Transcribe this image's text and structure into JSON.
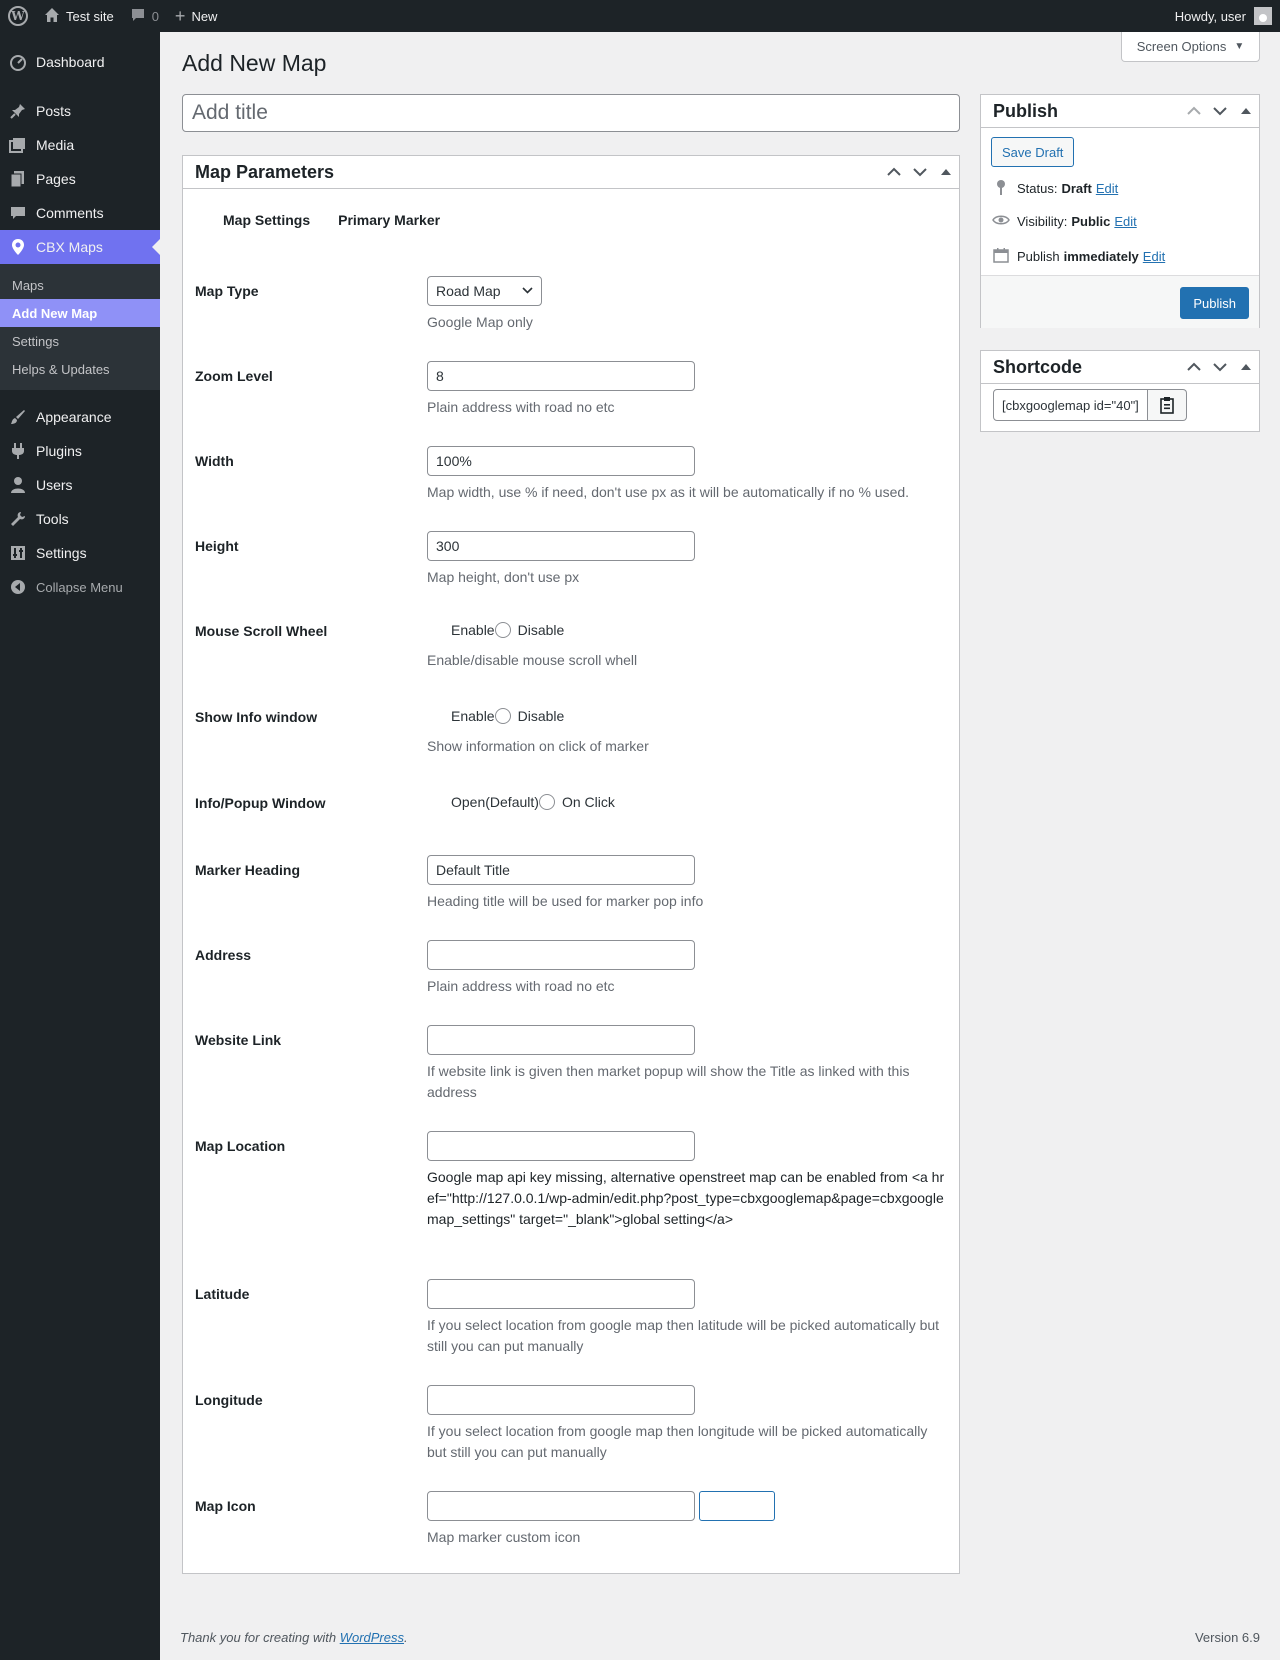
{
  "adminbar": {
    "site_name": "Test site",
    "comments_count": "0",
    "new_label": "New",
    "howdy": "Howdy, user"
  },
  "sidebar": {
    "items": [
      {
        "label": "Dashboard",
        "icon": "dashboard-icon"
      },
      {
        "label": "Posts",
        "icon": "pin-icon"
      },
      {
        "label": "Media",
        "icon": "media-icon"
      },
      {
        "label": "Pages",
        "icon": "pages-icon"
      },
      {
        "label": "Comments",
        "icon": "comments-icon"
      },
      {
        "label": "CBX Maps",
        "icon": "location-pin-icon"
      },
      {
        "label": "Appearance",
        "icon": "brush-icon"
      },
      {
        "label": "Plugins",
        "icon": "plug-icon"
      },
      {
        "label": "Users",
        "icon": "user-icon"
      },
      {
        "label": "Tools",
        "icon": "wrench-icon"
      },
      {
        "label": "Settings",
        "icon": "sliders-icon"
      }
    ],
    "submenu": [
      "Maps",
      "Add New Map",
      "Settings",
      "Helps & Updates"
    ],
    "collapse": "Collapse Menu"
  },
  "screen_options": "Screen Options",
  "page_title": "Add New Map",
  "title_placeholder": "Add title",
  "map_params": {
    "heading": "Map Parameters",
    "tabs": [
      "Map Settings",
      "Primary Marker"
    ],
    "map_type": {
      "label": "Map Type",
      "value": "Road Map",
      "desc": "Google Map only"
    },
    "zoom": {
      "label": "Zoom Level",
      "value": "8",
      "desc": "Plain address with road no etc"
    },
    "width": {
      "label": "Width",
      "value": "100%",
      "desc": "Map width, use % if need, don't use px as it will be automatically if no % used."
    },
    "height": {
      "label": "Height",
      "value": "300",
      "desc": "Map height, don't use px"
    },
    "scroll": {
      "label": "Mouse Scroll Wheel",
      "opt1": "Enable",
      "opt2": "Disable",
      "desc": "Enable/disable mouse scroll whell"
    },
    "infowin": {
      "label": "Show Info window",
      "opt1": "Enable",
      "opt2": "Disable",
      "desc": "Show information on click of marker"
    },
    "popup": {
      "label": "Info/Popup Window",
      "opt1": "Open(Default)",
      "opt2": "On Click"
    },
    "marker_heading": {
      "label": "Marker Heading",
      "value": "Default Title",
      "desc": "Heading title will be used for marker pop info"
    },
    "address": {
      "label": "Address",
      "value": "",
      "desc": "Plain address with road no etc"
    },
    "website": {
      "label": "Website Link",
      "value": "",
      "desc": "If website link is given then market popup will show the Title as linked with this address"
    },
    "location": {
      "label": "Map Location",
      "value": "",
      "desc": "Google map api key missing, alternative openstreet map can be enabled from <a href=\"http://127.0.0.1/wp-admin/edit.php?post_type=cbxgooglemap&page=cbxgooglemap_settings\" target=\"_blank\">global setting</a>"
    },
    "latitude": {
      "label": "Latitude",
      "value": "",
      "desc": "If you select location from google map then latitude will be picked automatically but still you can put manually"
    },
    "longitude": {
      "label": "Longitude",
      "value": "",
      "desc": "If you select location from google map then longitude will be picked automatically but still you can put manually"
    },
    "icon": {
      "label": "Map Icon",
      "value": "",
      "desc": "Map marker custom icon"
    }
  },
  "publish": {
    "heading": "Publish",
    "save_draft": "Save Draft",
    "status_label": "Status:",
    "status_value": "Draft",
    "visibility_label": "Visibility:",
    "visibility_value": "Public",
    "publish_label": "Publish",
    "publish_value": "immediately",
    "edit": "Edit",
    "publish_button": "Publish"
  },
  "shortcode": {
    "heading": "Shortcode",
    "value": "[cbxgooglemap id=\"40\"]"
  },
  "footer": {
    "thanks_prefix": "Thank you for creating with",
    "wordpress": "WordPress",
    "thanks_suffix": ".",
    "version": "Version 6.9"
  }
}
